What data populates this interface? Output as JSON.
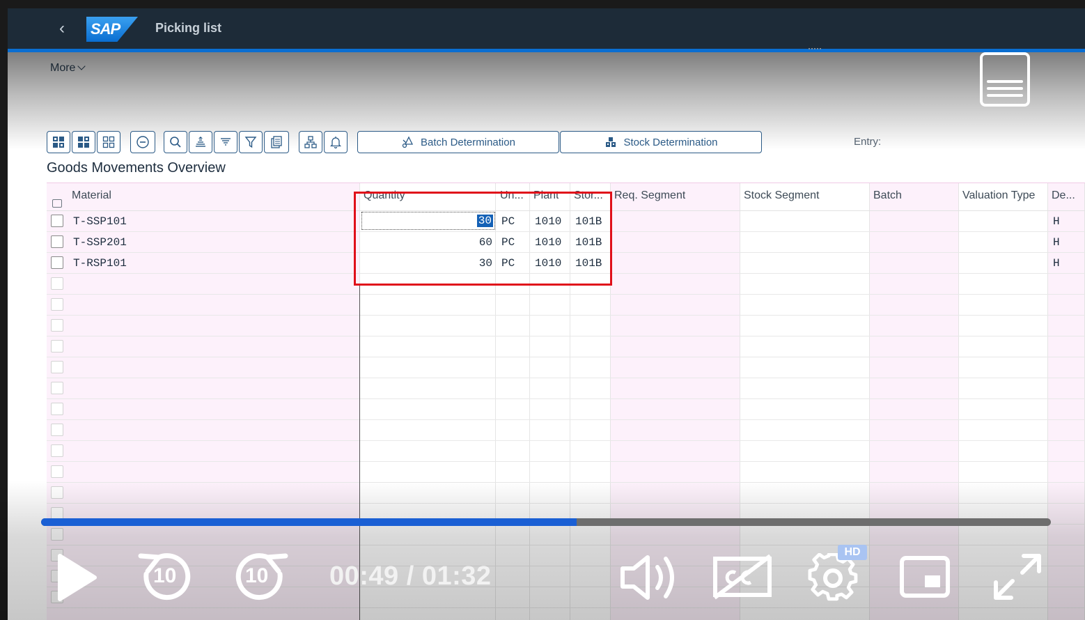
{
  "shell": {
    "logo_text": "SAP",
    "title": "Picking list"
  },
  "header": {
    "more_label": "More"
  },
  "toolbar": {
    "batch_label": "Batch Determination",
    "stock_label": "Stock Determination",
    "entry_label": "Entry:",
    "icons": [
      "select-all-icon",
      "select-block-icon",
      "deselect-all-icon",
      "delete-icon",
      "find-icon",
      "sort-ascending-icon",
      "sort-descending-icon",
      "filter-icon",
      "print-icon",
      "hierarchy-icon",
      "notification-icon"
    ]
  },
  "section_title": "Goods Movements Overview",
  "table": {
    "columns": [
      "Material",
      "Quantity",
      "Un...",
      "Plant",
      "Stor...",
      "Req. Segment",
      "Stock Segment",
      "Batch",
      "Valuation Type",
      "De..."
    ],
    "rows": [
      {
        "material": "T-SSP101",
        "quantity": "30",
        "unit": "PC",
        "plant": "1010",
        "storage": "101B",
        "debit_credit": "H"
      },
      {
        "material": "T-SSP201",
        "quantity": "60",
        "unit": "PC",
        "plant": "1010",
        "storage": "101B",
        "debit_credit": "H"
      },
      {
        "material": "T-RSP101",
        "quantity": "30",
        "unit": "PC",
        "plant": "1010",
        "storage": "101B",
        "debit_credit": "H"
      }
    ]
  },
  "video": {
    "time_display": "00:49 / 01:32",
    "progress": 0.53,
    "skip_seconds": "10",
    "hd_badge": "HD",
    "colors": {
      "progress": "#1a5fd4",
      "highlight_box": "#e0101a"
    }
  }
}
